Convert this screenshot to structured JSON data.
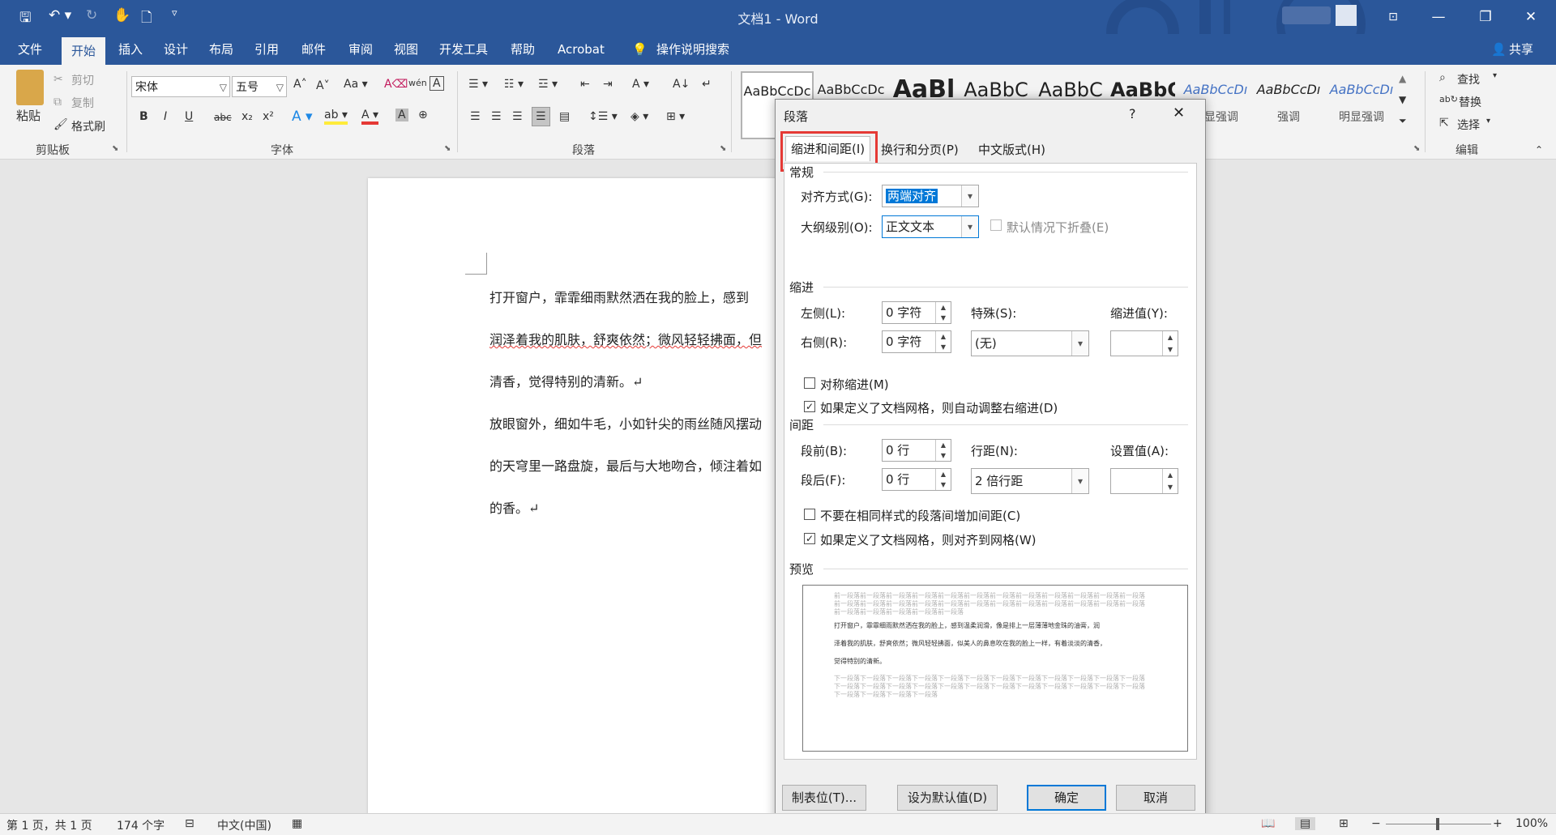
{
  "window": {
    "title": "文档1 - Word",
    "controls": {
      "options": "⊡",
      "minimize": "—",
      "restore": "❐",
      "close": "✕"
    },
    "quick_access": {
      "save": "🖫",
      "undo": "↶ ▾",
      "redo": "↻",
      "touch": "✋",
      "preview": "🗋",
      "customize": "▿"
    }
  },
  "menu": {
    "items": [
      "文件",
      "开始",
      "插入",
      "设计",
      "布局",
      "引用",
      "邮件",
      "审阅",
      "视图",
      "开发工具",
      "帮助",
      "Acrobat"
    ],
    "tell_me": "操作说明搜索",
    "share": "共享"
  },
  "ribbon": {
    "clipboard": {
      "paste": "粘贴",
      "cut": "剪切",
      "copy": "复制",
      "format_painter": "格式刷",
      "label": "剪贴板"
    },
    "font": {
      "font_name": "宋体",
      "font_size": "五号",
      "label": "字体",
      "buttons": [
        "B",
        "I",
        "U",
        "abc",
        "x₂",
        "x²"
      ]
    },
    "paragraph": {
      "label": "段落"
    },
    "styles": [
      {
        "sample": "AaBbCcDc",
        "name": ""
      },
      {
        "sample": "AaBbCcDc",
        "name": ""
      },
      {
        "sample": "AaBl",
        "name": ""
      },
      {
        "sample": "AaBbC",
        "name": ""
      },
      {
        "sample": "AaBbC",
        "name": ""
      },
      {
        "sample": "AaBbC",
        "name": ""
      },
      {
        "sample": "AaBbCcDı",
        "name": "明显强调"
      },
      {
        "sample": "AaBbCcDı",
        "name": "强调"
      },
      {
        "sample": "AaBbCcDı",
        "name": "明显强调"
      }
    ],
    "editing": {
      "find": "查找",
      "replace": "替换",
      "select": "选择",
      "label": "编辑"
    }
  },
  "document": {
    "lines": [
      "打开窗户，霏霏细雨默然洒在我的脸上，感到",
      "润泽着我的肌肤，舒爽依然；微风轻轻拂面，但",
      "清香，觉得特别的清新。↵",
      "放眼窗外，细如牛毛，小如针尖的雨丝随风摆动",
      "的天穹里一路盘旋，最后与大地吻合，倾注着如",
      "的香。↵"
    ]
  },
  "dialog": {
    "title": "段落",
    "help": "?",
    "close": "✕",
    "tabs": [
      "缩进和间距(I)",
      "换行和分页(P)",
      "中文版式(H)"
    ],
    "general": {
      "section": "常规",
      "alignment_label": "对齐方式(G):",
      "alignment_value": "两端对齐",
      "outline_label": "大纲级别(O):",
      "outline_value": "正文文本",
      "collapse_label": "默认情况下折叠(E)"
    },
    "indent": {
      "section": "缩进",
      "left_label": "左侧(L):",
      "left_value": "0 字符",
      "right_label": "右侧(R):",
      "right_value": "0 字符",
      "special_label": "特殊(S):",
      "special_value": "(无)",
      "by_label": "缩进值(Y):",
      "mirror_label": "对称缩进(M)",
      "auto_adjust_label": "如果定义了文档网格，则自动调整右缩进(D)"
    },
    "spacing": {
      "section": "间距",
      "before_label": "段前(B):",
      "before_value": "0 行",
      "after_label": "段后(F):",
      "after_value": "0 行",
      "line_label": "行距(N):",
      "line_value": "2 倍行距",
      "at_label": "设置值(A):",
      "no_space_label": "不要在相同样式的段落间增加间距(C)",
      "snap_label": "如果定义了文档网格，则对齐到网格(W)"
    },
    "preview": {
      "section": "预览",
      "prev_text": "前一段落前一段落前一段落前一段落前一段落前一段落前一段落前一段落前一段落前一段落前一段落前一段落前一段落前一段落前一段落前一段落前一段落前一段落前一段落前一段落前一段落前一段落前一段落前一段落前一段落前一段落前一段落前一段落前一段落",
      "lines": [
        "打开窗户，霏霏细雨默然洒在我的脸上，感到温柔润滑，像是排上一层薄薄地金珠的油膏，润",
        "泽着我的肌肤，舒爽依然；微风轻轻拂面，似美人的鼻息吹在我的脸上一样，有着淡淡的清香，",
        "觉得特别的清新。"
      ],
      "next_text": "下一段落下一段落下一段落下一段落下一段落下一段落下一段落下一段落下一段落下一段落下一段落下一段落下一段落下一段落下一段落下一段落下一段落下一段落下一段落下一段落下一段落下一段落下一段落下一段落下一段落下一段落下一段落下一段落"
    },
    "buttons": {
      "tabs": "制表位(T)...",
      "default": "设为默认值(D)",
      "ok": "确定",
      "cancel": "取消"
    }
  },
  "status": {
    "page": "第 1 页，共 1 页",
    "words": "174 个字",
    "language": "中文(中国)",
    "zoom": "100%"
  },
  "colors": {
    "title_bar": "#2b579a",
    "highlight": "#e53935",
    "selection": "#0078d7"
  }
}
